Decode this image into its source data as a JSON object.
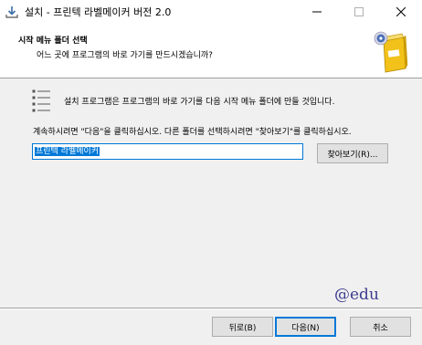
{
  "window": {
    "title": "설치 - 프린텍 라벨메이커 버전 2.0",
    "icon": "installer-download-icon",
    "controls": {
      "minimize_icon": "minimize-icon",
      "maximize_icon": "maximize-icon",
      "close_icon": "close-icon"
    }
  },
  "header": {
    "title": "시작 메뉴 폴더 선택",
    "subtitle": "어느 곳에 프로그램의 바로 가기를 만드시겠습니까?",
    "logo_icon": "setup-box-cd-icon"
  },
  "body": {
    "folder_icon": "start-menu-list-icon",
    "description": "설치 프로그램은 프로그램의 바로 가기를 다음 시작 메뉴 폴더에 만들 것입니다.",
    "instruction": "계속하시려면 \"다음\"을 클릭하십시오. 다른 폴더를 선택하시려면 \"찾아보기\"를 클릭하십시오.",
    "folder_value": "프린텍 라벨메이커",
    "browse_label": "찾아보기(R)..."
  },
  "watermark": "@edu",
  "footer": {
    "back_label": "뒤로(B)",
    "next_label": "다음(N)",
    "cancel_label": "취소"
  },
  "colors": {
    "accent": "#0078d7",
    "background": "#f0f0f0",
    "header_background": "#ffffff"
  }
}
